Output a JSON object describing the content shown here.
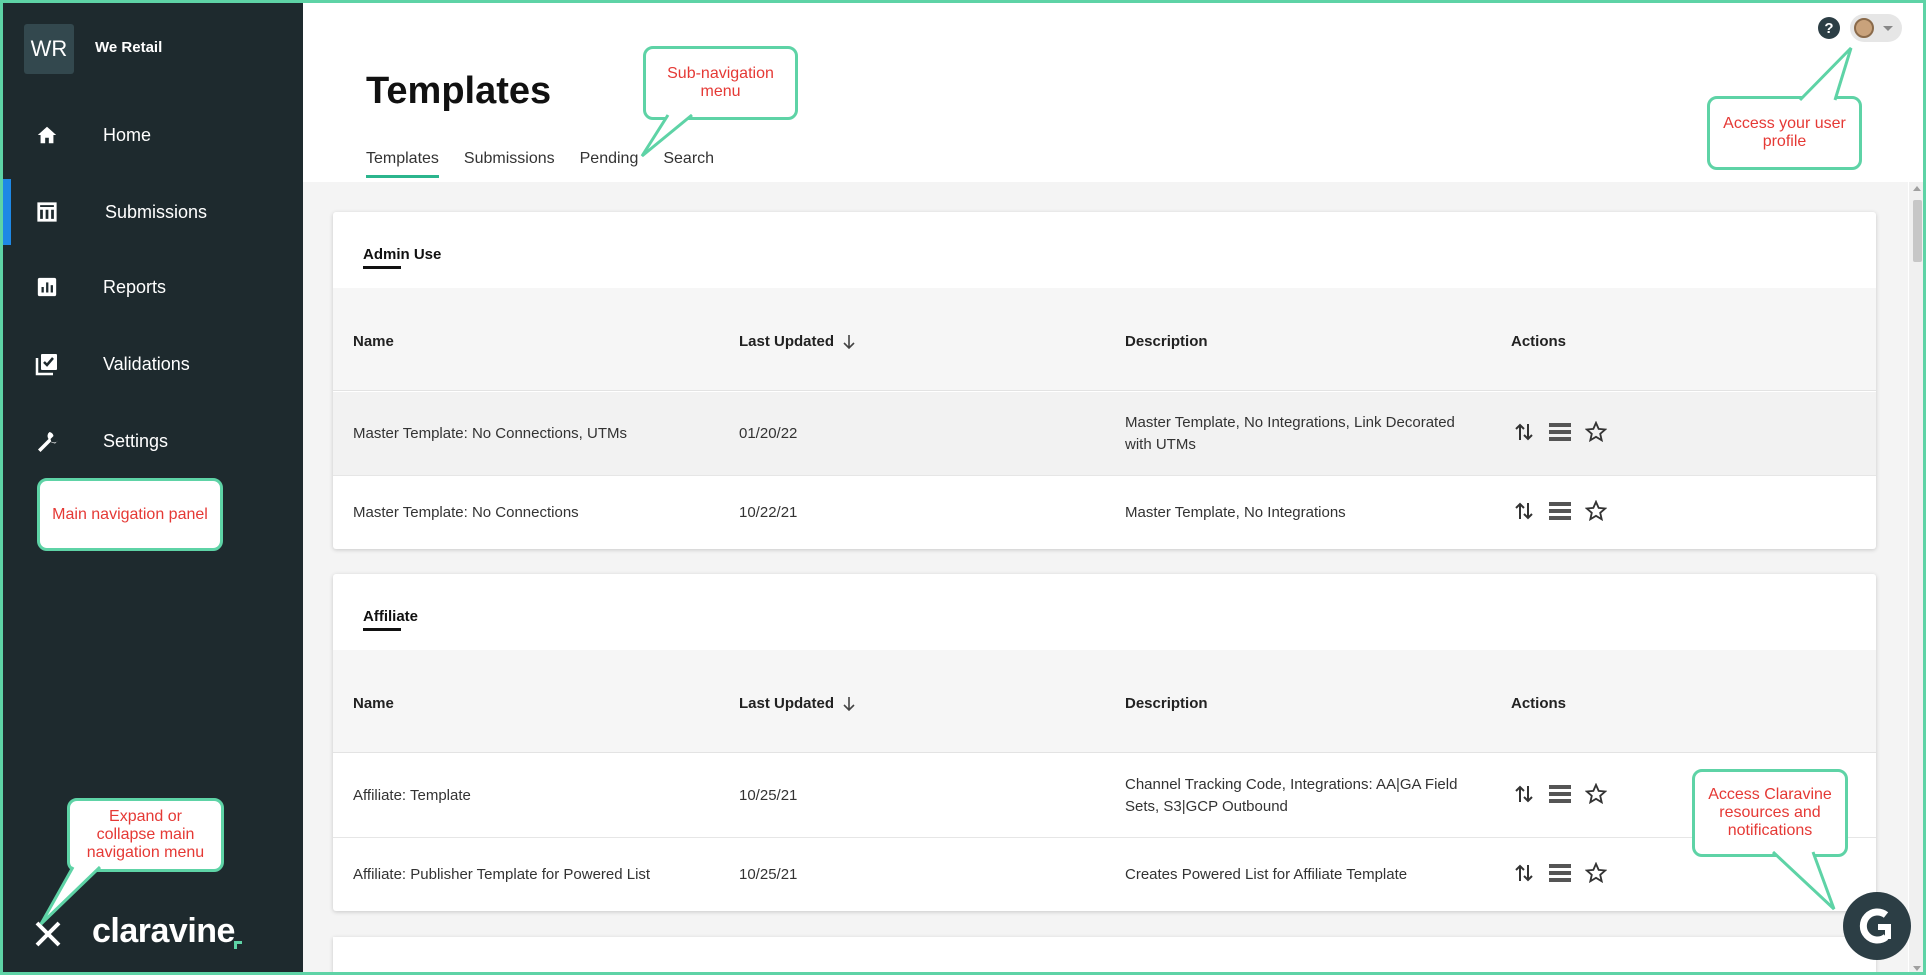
{
  "org": {
    "initials": "WR",
    "name": "We Retail"
  },
  "nav": [
    {
      "label": "Home",
      "icon": "home-icon"
    },
    {
      "label": "Submissions",
      "icon": "table-icon",
      "active": true
    },
    {
      "label": "Reports",
      "icon": "bar-chart-icon"
    },
    {
      "label": "Validations",
      "icon": "checklist-icon"
    },
    {
      "label": "Settings",
      "icon": "wrench-icon"
    }
  ],
  "logo": {
    "text": "claravine"
  },
  "page": {
    "title": "Templates"
  },
  "subnav": [
    "Templates",
    "Submissions",
    "Pending",
    "Search"
  ],
  "sections": [
    {
      "title": "Admin Use",
      "columns": {
        "name": "Name",
        "updated": "Last Updated",
        "description": "Description",
        "actions": "Actions"
      },
      "rows": [
        {
          "name": "Master Template: No Connections, UTMs",
          "updated": "01/20/22",
          "description": "Master Template, No Integrations, Link Decorated with UTMs"
        },
        {
          "name": "Master Template: No Connections",
          "updated": "10/22/21",
          "description": "Master Template, No Integrations"
        }
      ]
    },
    {
      "title": "Affiliate",
      "columns": {
        "name": "Name",
        "updated": "Last Updated",
        "description": "Description",
        "actions": "Actions"
      },
      "rows": [
        {
          "name": "Affiliate: Template",
          "updated": "10/25/21",
          "description": "Channel Tracking Code, Integrations: AA|GA Field Sets, S3|GCP Outbound"
        },
        {
          "name": "Affiliate: Publisher Template for Powered List",
          "updated": "10/25/21",
          "description": "Creates Powered List for Affiliate Template"
        }
      ]
    }
  ],
  "callouts": {
    "subnav": "Sub-navigation menu",
    "profile": "Access your user profile",
    "mainnav": "Main navigation panel",
    "expand": "Expand or collapse main navigation menu",
    "resources": "Access Claravine resources and notifications"
  },
  "colors": {
    "sidebar": "#1e2a2e",
    "accent": "#2bb58d",
    "callout_border": "#5ed3a6",
    "callout_text": "#e53935",
    "active_bar": "#1e88e5"
  }
}
